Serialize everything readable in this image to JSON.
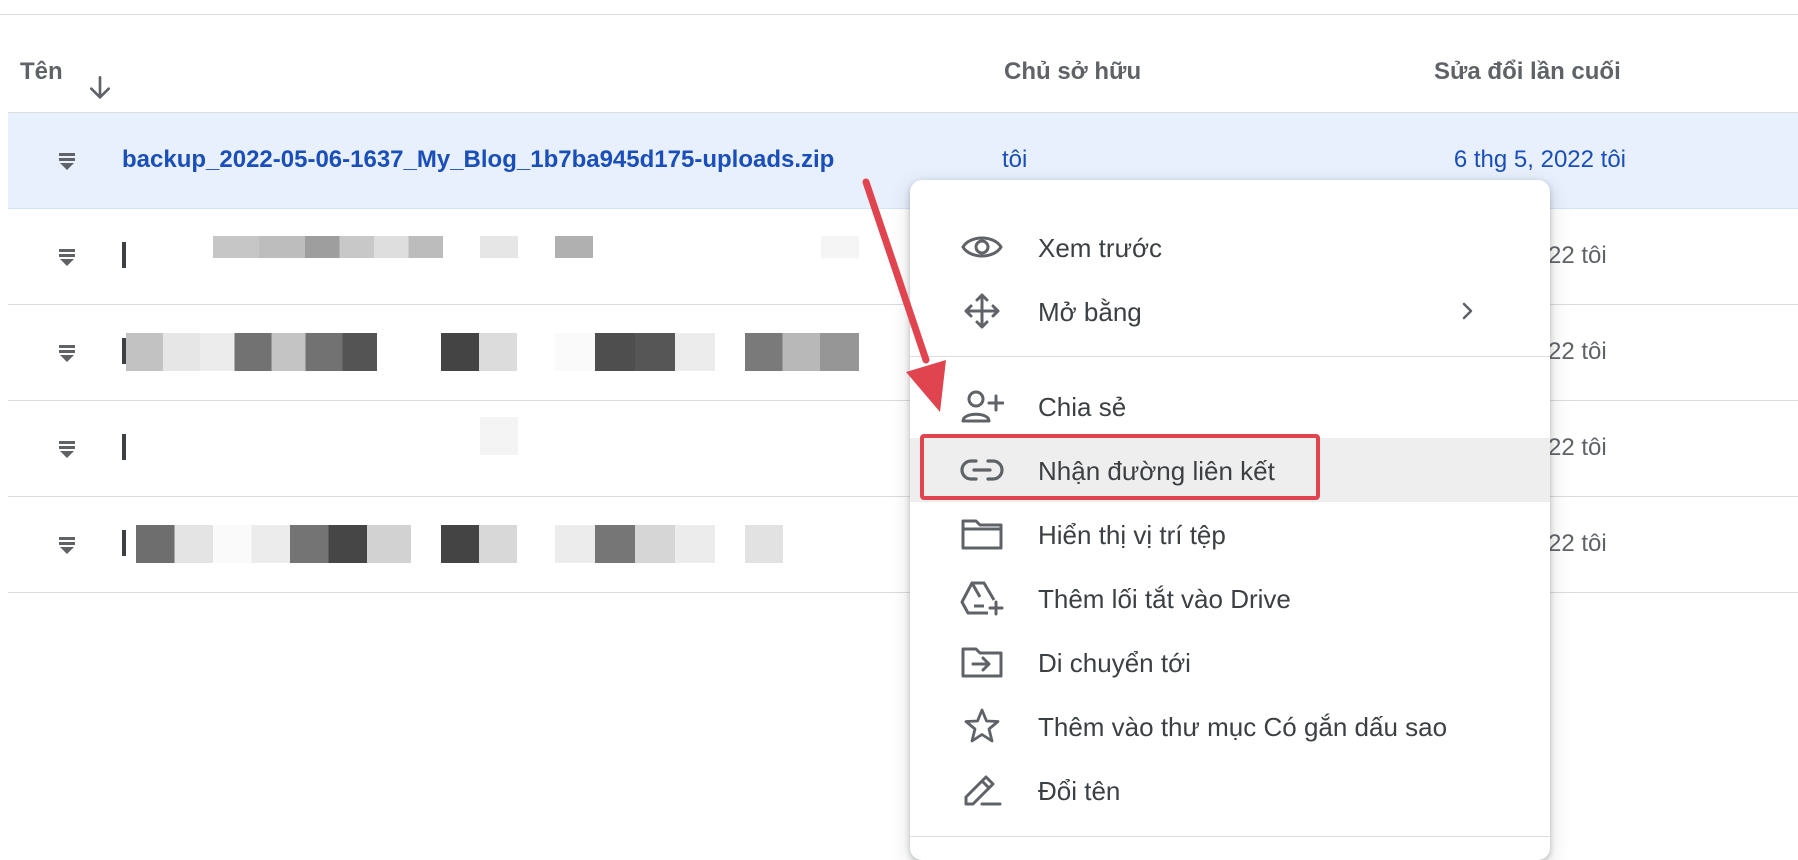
{
  "header": {
    "name_label": "Tên",
    "owner_label": "Chủ sở hữu",
    "modified_label": "Sửa đổi lần cuối",
    "sort_icon": "arrow-down-icon"
  },
  "files": [
    {
      "name": "backup_2022-05-06-1637_My_Blog_1b7ba945d175-uploads.zip",
      "owner": "tôi",
      "modified": "6 thg 5, 2022 tôi",
      "selected": true
    },
    {
      "modified_partial": "22 tôi"
    },
    {
      "modified_partial": "22 tôi"
    },
    {
      "modified_partial": "22 tôi"
    },
    {
      "modified_partial": "22 tôi"
    }
  ],
  "context_menu": {
    "items": [
      {
        "label": "Xem trước",
        "icon": "eye-icon"
      },
      {
        "label": "Mở bằng",
        "icon": "move-arrows-icon",
        "submenu_icon": "chevron-right-icon"
      },
      {
        "label": "Chia sẻ",
        "icon": "person-add-icon"
      },
      {
        "label": "Nhận đường liên kết",
        "icon": "link-icon",
        "highlighted": true
      },
      {
        "label": "Hiển thị vị trí tệp",
        "icon": "folder-icon"
      },
      {
        "label": "Thêm lối tắt vào Drive",
        "icon": "drive-shortcut-icon"
      },
      {
        "label": "Di chuyển tới",
        "icon": "folder-move-icon"
      },
      {
        "label": "Thêm vào thư mục Có gắn dấu sao",
        "icon": "star-icon"
      },
      {
        "label": "Đổi tên",
        "icon": "pencil-icon"
      }
    ]
  },
  "colors": {
    "selected_row_bg": "#e8f0fe",
    "selected_text": "#1a4fba",
    "annotation_red": "#e0454f",
    "menu_hover_bg": "#eeeeee"
  }
}
